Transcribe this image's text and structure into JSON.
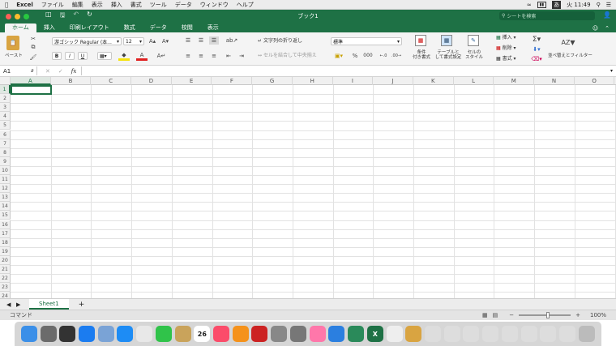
{
  "menubar": {
    "apple": "",
    "items": [
      "Excel",
      "ファイル",
      "編集",
      "表示",
      "挿入",
      "書式",
      "ツール",
      "データ",
      "ウィンドウ",
      "ヘルプ"
    ],
    "input_mode": "あ",
    "clock": "火 11:49"
  },
  "window": {
    "title": "ブック1",
    "search_placeholder": "シートを検索"
  },
  "tabs": [
    "ホーム",
    "挿入",
    "印刷レイアウト",
    "数式",
    "データ",
    "校閲",
    "表示"
  ],
  "active_tab": 0,
  "ribbon": {
    "paste_label": "ペースト",
    "font_name": "游ゴシック Regular (本...",
    "font_size": "12",
    "wrap_text": "文字列の折り返し",
    "merge_center": "セルを結合して中央揃え",
    "number_format": "標準",
    "percent": "%",
    "comma": "000",
    "cond_format": "条件\n付き書式",
    "table_format": "テーブルと\nして書式設定",
    "cell_style": "セルの\nスタイル",
    "insert": "挿入",
    "delete": "削除",
    "format": "書式",
    "sort_filter": "並べ替えとフィルター",
    "bold": "B",
    "italic": "I",
    "underline": "U"
  },
  "formula_bar": {
    "name_box": "A1",
    "fx": "fx",
    "value": ""
  },
  "columns": [
    "A",
    "B",
    "C",
    "D",
    "E",
    "F",
    "G",
    "H",
    "I",
    "J",
    "K",
    "L",
    "M",
    "N",
    "O"
  ],
  "rows": [
    "1",
    "2",
    "3",
    "4",
    "5",
    "6",
    "7",
    "8",
    "9",
    "10",
    "11",
    "12",
    "13",
    "14",
    "15",
    "16",
    "17",
    "18",
    "19",
    "20",
    "21",
    "22",
    "23",
    "24"
  ],
  "selected_cell": "A1",
  "sheets": [
    "Sheet1"
  ],
  "status": {
    "mode": "コマンド",
    "zoom": "100%"
  },
  "colors": {
    "excel_green": "#1e7145"
  },
  "dock": [
    "finder-icon",
    "launchpad-icon",
    "mission-control-icon",
    "app-store-icon",
    "preview-icon",
    "safari-icon",
    "chrome-icon",
    "messages-icon",
    "notes-icon",
    "calendar-icon",
    "music-icon",
    "books-icon",
    "photo-booth-icon",
    "image-capture-icon",
    "system-preferences-icon",
    "photos-icon",
    "xcode-icon",
    "remote-desktop-icon",
    "excel-icon",
    "document-icon",
    "archive-icon",
    "window-icon",
    "window-icon",
    "window-icon",
    "window-icon",
    "window-icon",
    "window-icon",
    "window-icon",
    "window-icon",
    "trash-icon"
  ],
  "calendar_day": "26"
}
